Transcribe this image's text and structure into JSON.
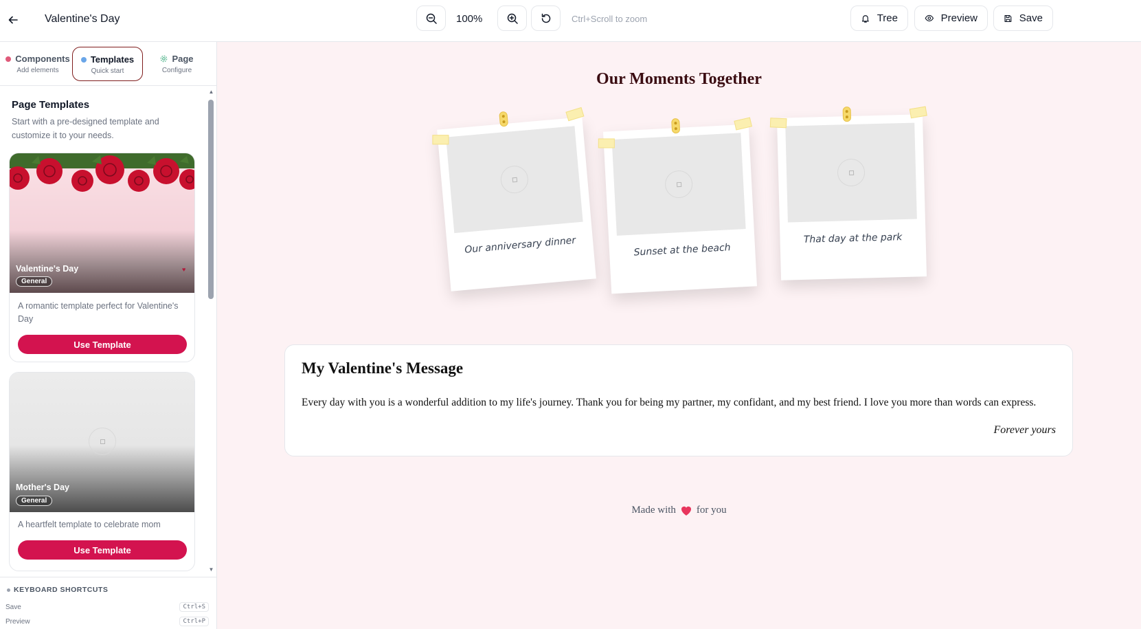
{
  "header": {
    "title": "Valentine's Day",
    "zoom_level": "100%",
    "zoom_hint": "Ctrl+Scroll to zoom",
    "tree_label": "Tree",
    "preview_label": "Preview",
    "save_label": "Save"
  },
  "sidebar": {
    "tabs": [
      {
        "label": "Components",
        "sub": "Add elements",
        "dot_color": "#e05a7a"
      },
      {
        "label": "Templates",
        "sub": "Quick start",
        "dot_color": "#6aa6e8"
      },
      {
        "label": "Page",
        "sub": "Configure",
        "icon": "gear-icon",
        "icon_color": "#4fb38a"
      }
    ],
    "panel_title": "Page Templates",
    "panel_desc": "Start with a pre-designed template and customize it to your needs.",
    "templates": [
      {
        "name": "Valentine's Day",
        "badge": "General",
        "desc": "A romantic template perfect for Valentine's Day",
        "button": "Use Template"
      },
      {
        "name": "Mother's Day",
        "badge": "General",
        "desc": "A heartfelt template to celebrate mom",
        "button": "Use Template"
      }
    ],
    "shortcuts": {
      "title": "KEYBOARD SHORTCUTS",
      "items": [
        {
          "label": "Save",
          "keys": "Ctrl+S"
        },
        {
          "label": "Preview",
          "keys": "Ctrl+P"
        }
      ]
    }
  },
  "canvas": {
    "moments_title": "Our Moments Together",
    "photos": [
      {
        "caption": "Our anniversary dinner"
      },
      {
        "caption": "Sunset at the beach"
      },
      {
        "caption": "That day at the park"
      }
    ],
    "message": {
      "title": "My Valentine's Message",
      "body": "Every day with you is a wonderful addition to my life's journey. Thank you for being my partner, my confidant, and my best friend. I love you more than words can express.",
      "signature": "Forever yours"
    },
    "footer": {
      "before": "Made with",
      "after": "for you"
    }
  },
  "colors": {
    "accent": "#d3134f",
    "canvas_bg": "#fdf2f4",
    "title_color": "#3b0d12"
  }
}
